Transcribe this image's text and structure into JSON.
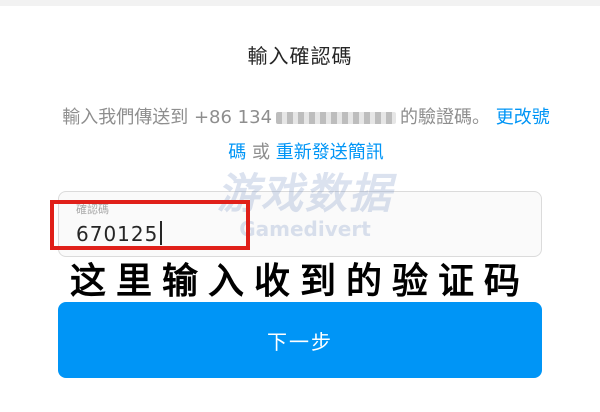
{
  "title": "輸入確認碼",
  "description": {
    "prefix": "輸入我們傳送到 +86 134",
    "suffix": "的驗證碼。",
    "change_number_link": "更改號碼",
    "or_text": "或",
    "resend_link": "重新發送簡訊"
  },
  "code_field": {
    "label": "確認碼",
    "value": "670125"
  },
  "annotation": {
    "caption": "这里输入收到的验证码"
  },
  "watermark": {
    "logo_text": "游戏数据",
    "brand": "Gamedivert"
  },
  "next_button": {
    "label": "下一步"
  },
  "colors": {
    "link": "#0095f6",
    "button": "#0095f6",
    "highlight_box": "#e0201a"
  }
}
